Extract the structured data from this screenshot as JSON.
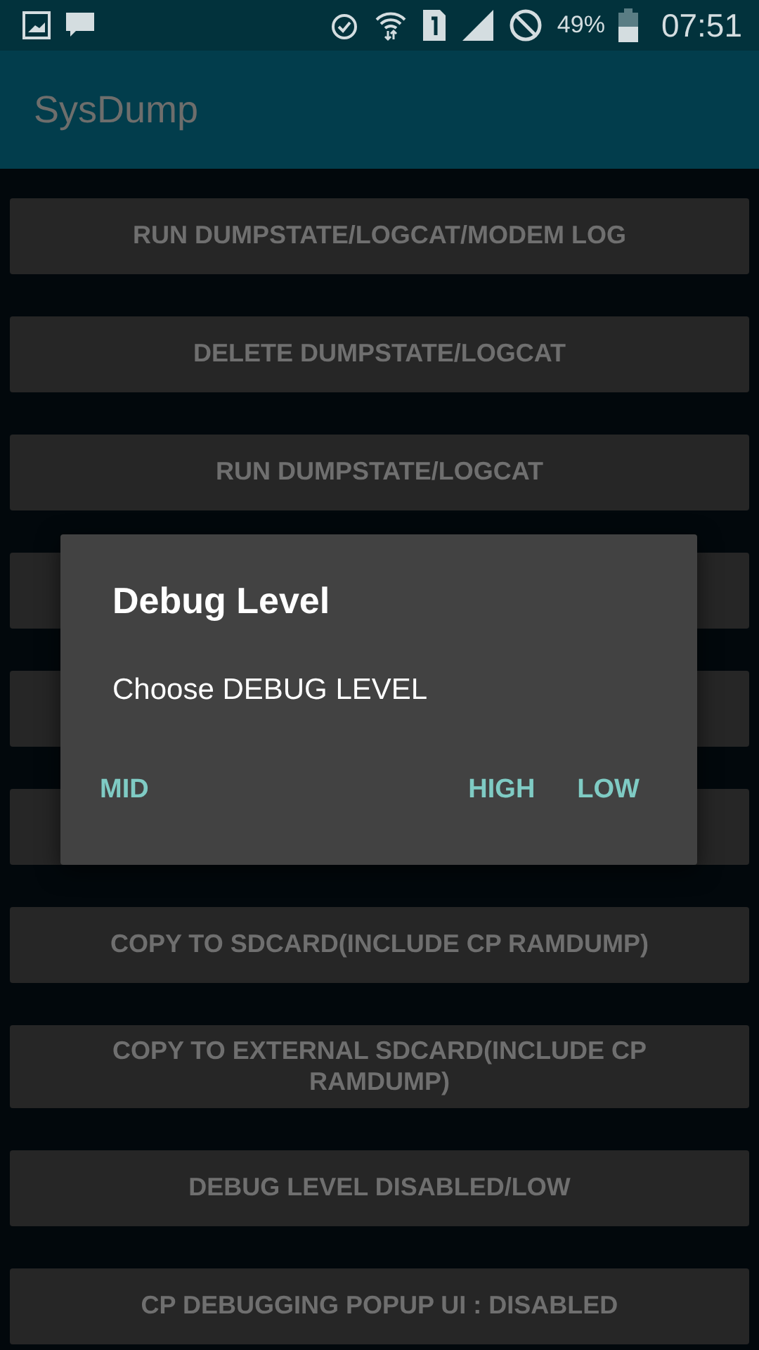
{
  "status_bar": {
    "battery": "49%",
    "time": "07:51"
  },
  "app_bar": {
    "title": "SysDump"
  },
  "buttons": [
    {
      "label": "RUN DUMPSTATE/LOGCAT/MODEM LOG"
    },
    {
      "label": "DELETE DUMPSTATE/LOGCAT"
    },
    {
      "label": "RUN DUMPSTATE/LOGCAT"
    },
    {
      "kind": "covered"
    },
    {
      "kind": "covered"
    },
    {
      "kind": "covered"
    },
    {
      "label": "COPY TO SDCARD(INCLUDE CP RAMDUMP)"
    },
    {
      "label": "COPY TO EXTERNAL SDCARD(INCLUDE CP RAMDUMP)"
    },
    {
      "label": "DEBUG LEVEL DISABLED/LOW"
    },
    {
      "label": "CP DEBUGGING POPUP UI : DISABLED"
    }
  ],
  "dialog": {
    "title": "Debug Level",
    "message": "Choose DEBUG LEVEL",
    "actions": [
      "MID",
      "HIGH",
      "LOW"
    ]
  }
}
